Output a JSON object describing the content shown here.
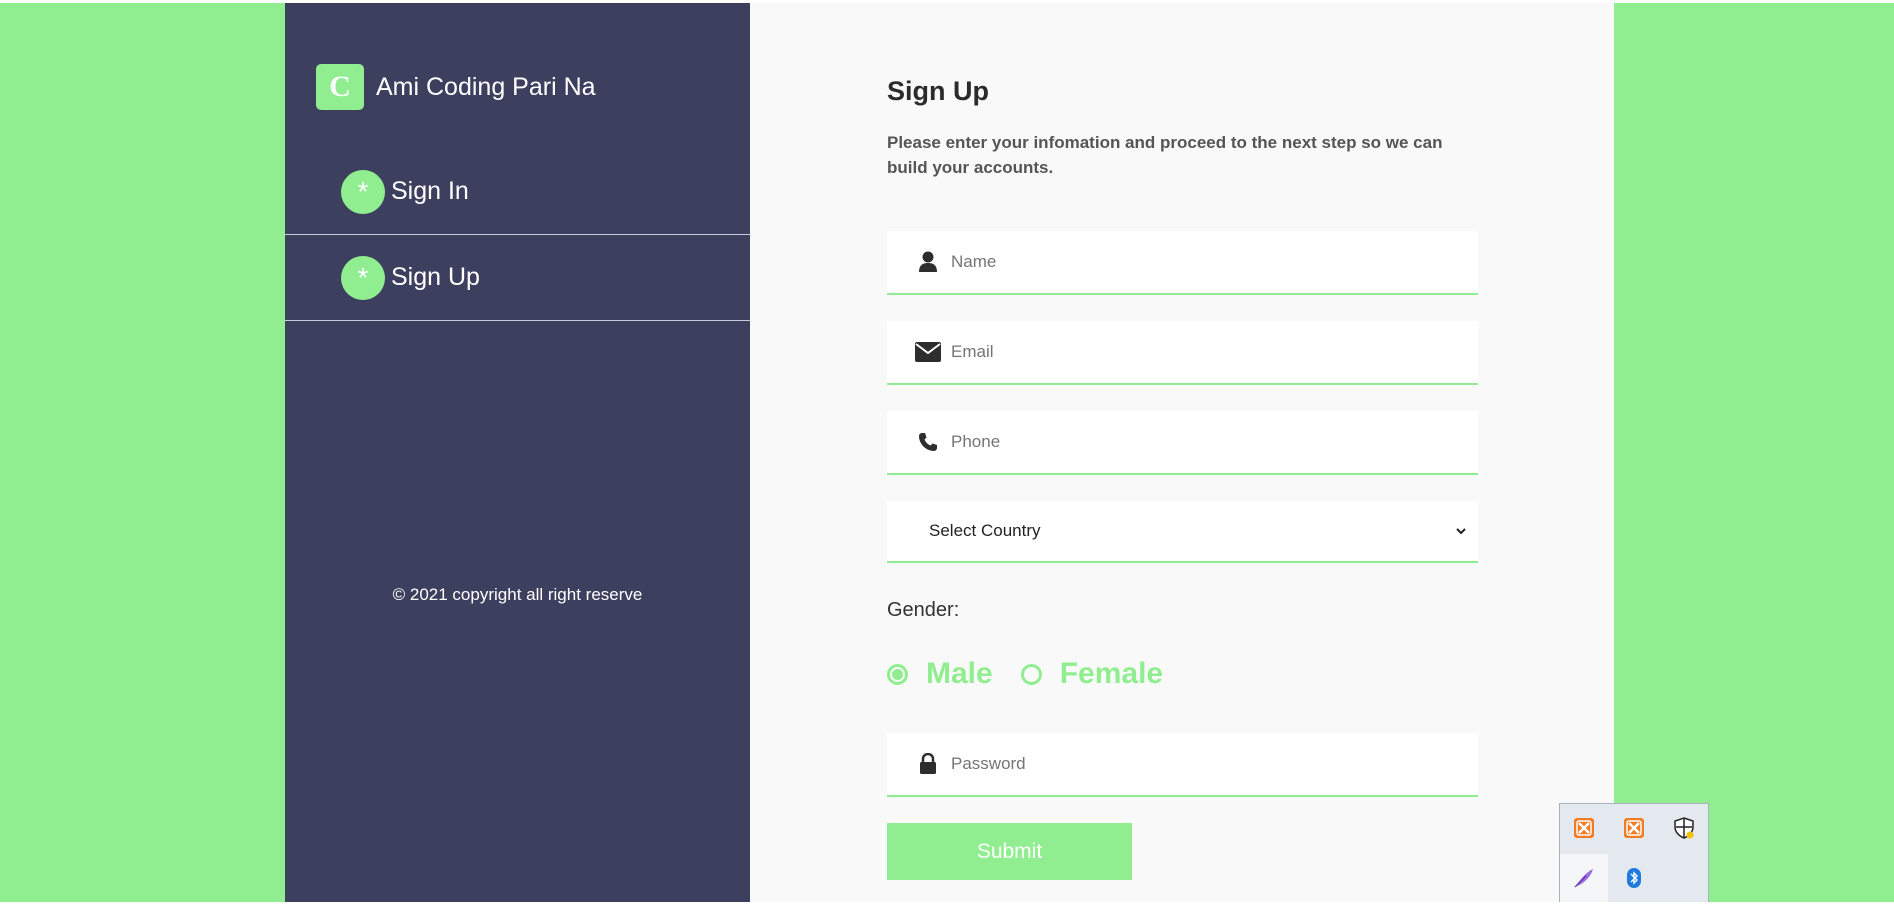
{
  "brand": {
    "logo_letter": "C",
    "name": "Ami Coding Pari Na"
  },
  "nav": {
    "items": [
      {
        "bullet": "*",
        "label": "Sign In"
      },
      {
        "bullet": "*",
        "label": "Sign Up"
      }
    ]
  },
  "sidebar": {
    "copyright": "© 2021 copyright all right reserve"
  },
  "form": {
    "title": "Sign Up",
    "subtitle": "Please enter your infomation and proceed to the next step so we can build your accounts.",
    "name_placeholder": "Name",
    "email_placeholder": "Email",
    "phone_placeholder": "Phone",
    "country_selected": "Select Country",
    "gender_label": "Gender:",
    "gender_options": [
      {
        "label": "Male",
        "selected": true
      },
      {
        "label": "Female",
        "selected": false
      }
    ],
    "password_placeholder": "Password",
    "submit_label": "Submit"
  },
  "colors": {
    "accent": "#90ee90",
    "sidebar_bg": "#3d3f5f",
    "main_bg": "#f9f9f9"
  },
  "tray": {
    "icons": [
      "xampp-icon",
      "xampp-icon",
      "security-shield-icon",
      "feather-app-icon",
      "bluetooth-icon"
    ]
  }
}
